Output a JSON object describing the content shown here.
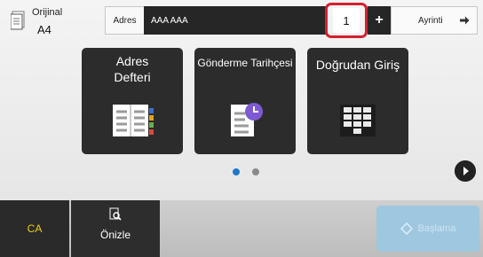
{
  "original": {
    "label": "Orijinal",
    "size": "A4"
  },
  "address": {
    "label": "Adres",
    "value": "AAA AAA"
  },
  "copies": {
    "value": "1"
  },
  "plus": {
    "label": "+"
  },
  "details": {
    "label": "Ayrinti"
  },
  "tiles": [
    {
      "title": "Adres\nDefteri",
      "icon": "address-book-icon"
    },
    {
      "title": "Gönderme Tarihçesi",
      "icon": "sending-history-icon"
    },
    {
      "title": "Doğrudan Giriş",
      "icon": "keypad-icon"
    }
  ],
  "pagination": {
    "active_color": "#1f78c8",
    "inactive_color": "#8a8a8a"
  },
  "bottom": {
    "ca_label": "CA",
    "preview_label": "Önizle",
    "start_label": "Başlama"
  },
  "colors": {
    "highlight": "#d4202f",
    "ca_text": "#f2d200",
    "start_bg": "#9fc7df"
  }
}
